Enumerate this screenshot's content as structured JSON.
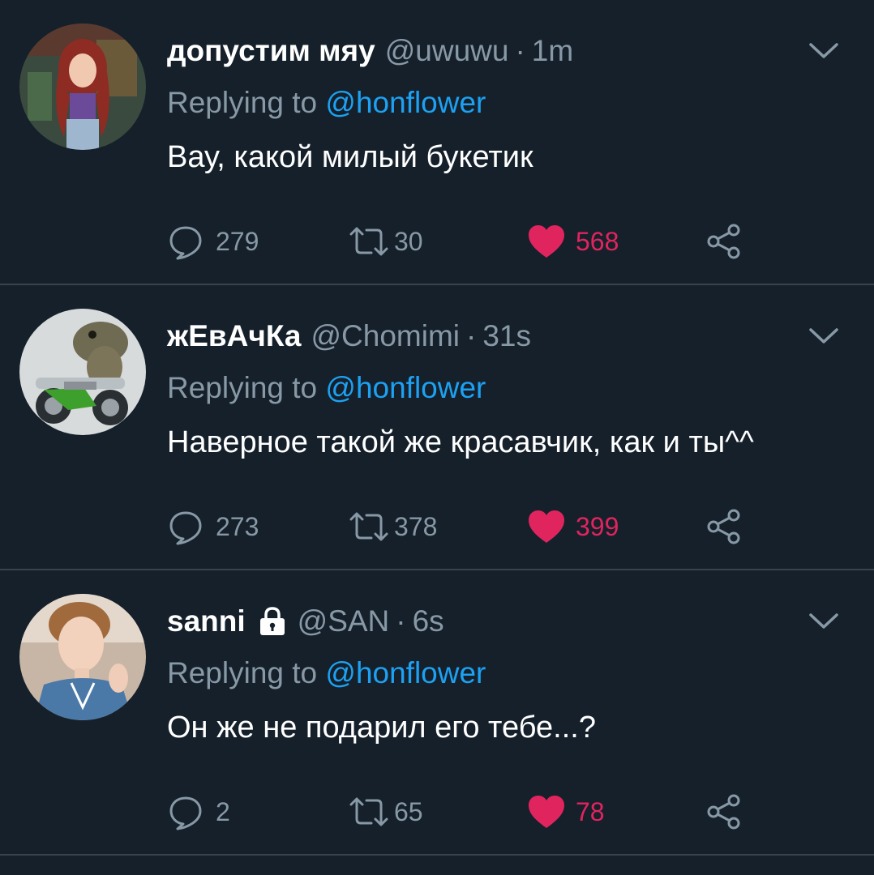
{
  "colors": {
    "background": "#15202b",
    "divider": "#38444d",
    "secondary_text": "#8899a6",
    "mention": "#1da1f2",
    "like": "#e0245e"
  },
  "tweets": [
    {
      "name": "допустим мяу",
      "handle": "@uwuwu",
      "separator": "·",
      "time": "1m",
      "replying_prefix": "Replying to ",
      "replying_to": "@honflower",
      "text": "Вау, какой милый букетик",
      "replies": "279",
      "retweets": "30",
      "likes": "568",
      "liked": true,
      "protected": false,
      "avatar_icon": "avatar-woman-icon"
    },
    {
      "name": "жЕвАчКа",
      "handle": "@Chomimi",
      "separator": "·",
      "time": "31s",
      "replying_prefix": "Replying to ",
      "replying_to": "@honflower",
      "text": "Наверное такой же красавчик, как и ты^^",
      "replies": "273",
      "retweets": "378",
      "likes": "399",
      "liked": true,
      "protected": false,
      "avatar_icon": "avatar-frog-motorcycle-icon"
    },
    {
      "name": "sanni",
      "handle": "@SAN",
      "separator": "·",
      "time": "6s",
      "replying_prefix": "Replying to ",
      "replying_to": "@honflower",
      "text": "Он же не подарил его тебе...?",
      "replies": "2",
      "retweets": "65",
      "likes": "78",
      "liked": true,
      "protected": true,
      "avatar_icon": "avatar-man-icon"
    }
  ],
  "icons": {
    "reply": "reply-icon",
    "retweet": "retweet-icon",
    "like": "heart-icon",
    "share": "share-icon",
    "more": "chevron-down-icon",
    "protected": "lock-icon"
  }
}
